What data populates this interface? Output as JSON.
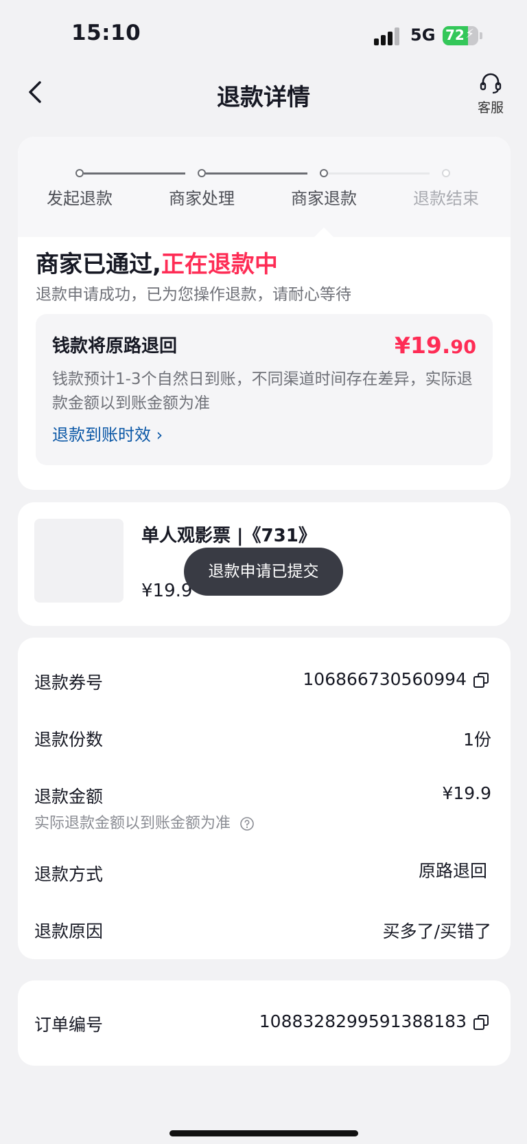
{
  "status_bar": {
    "time": "15:10",
    "network": "5G",
    "battery": "72"
  },
  "nav": {
    "title": "退款详情",
    "service_label": "客服"
  },
  "progress": {
    "steps": [
      {
        "label": "发起退款",
        "done": true
      },
      {
        "label": "商家处理",
        "done": true
      },
      {
        "label": "商家退款",
        "done": true
      },
      {
        "label": "退款结束",
        "done": false
      }
    ]
  },
  "status": {
    "headline_prefix": "商家已通过,",
    "headline_highlight": "正在退款中",
    "subtitle": "退款申请成功，已为您操作退款，请耐心等待"
  },
  "refund_box": {
    "title": "钱款将原路退回",
    "amount_main": "¥19.",
    "amount_decimal": "90",
    "desc": "钱款预计1-3个自然日到账，不同渠道时间存在差异，实际退款金额以到账金额为准",
    "link": "退款到账时效 ›"
  },
  "product": {
    "name": "单人观影票 |《731》",
    "price": "¥19.9"
  },
  "toast": "退款申请已提交",
  "details": {
    "voucher_label": "退款券号",
    "voucher_value": "106866730560994",
    "count_label": "退款份数",
    "count_value": "1份",
    "amount_label": "退款金额",
    "amount_value": "¥19.9",
    "amount_note": "实际退款金额以到账金额为准",
    "method_label": "退款方式",
    "method_value": "原路退回",
    "reason_label": "退款原因",
    "reason_value": "买多了/买错了"
  },
  "order": {
    "label": "订单编号",
    "value": "1088328299591388183"
  },
  "colors": {
    "accent": "#fe2c55",
    "link": "#0a57a6",
    "battery": "#34c759"
  }
}
